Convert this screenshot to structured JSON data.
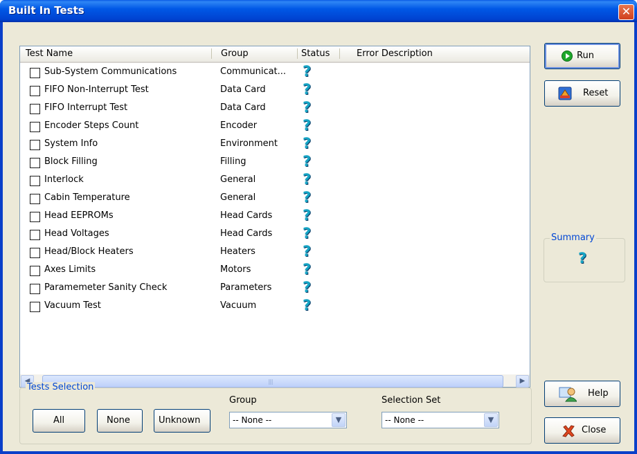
{
  "window": {
    "title": "Built In Tests",
    "close_glyph": "✕"
  },
  "list": {
    "columns": [
      "Test Name",
      "Group",
      "Status",
      "Error Description"
    ],
    "rows": [
      {
        "name": "Sub-System Communications",
        "group": "Communicat...",
        "status": "?"
      },
      {
        "name": "FIFO Non-Interrupt Test",
        "group": "Data Card",
        "status": "?"
      },
      {
        "name": "FIFO Interrupt Test",
        "group": "Data Card",
        "status": "?"
      },
      {
        "name": "Encoder Steps Count",
        "group": "Encoder",
        "status": "?"
      },
      {
        "name": "System Info",
        "group": "Environment",
        "status": "?"
      },
      {
        "name": "Block Filling",
        "group": "Filling",
        "status": "?"
      },
      {
        "name": "Interlock",
        "group": "General",
        "status": "?"
      },
      {
        "name": "Cabin Temperature",
        "group": "General",
        "status": "?"
      },
      {
        "name": "Head EEPROMs",
        "group": "Head Cards",
        "status": "?"
      },
      {
        "name": "Head Voltages",
        "group": "Head Cards",
        "status": "?"
      },
      {
        "name": "Head/Block Heaters",
        "group": "Heaters",
        "status": "?"
      },
      {
        "name": "Axes Limits",
        "group": "Motors",
        "status": "?"
      },
      {
        "name": "Paramemeter Sanity Check",
        "group": "Parameters",
        "status": "?"
      },
      {
        "name": "Vacuum Test",
        "group": "Vacuum",
        "status": "?"
      }
    ],
    "scroll_left_glyph": "◀",
    "scroll_right_glyph": "▶",
    "scroll_grip": "||||"
  },
  "buttons": {
    "run": {
      "label": "Run",
      "icon": "play-circle-icon"
    },
    "reset": {
      "label": "Reset",
      "icon": "reset-icon"
    },
    "help": {
      "label": "Help",
      "icon": "help-people-icon"
    },
    "close": {
      "label": "Close",
      "icon": "red-x-icon"
    }
  },
  "summary": {
    "label": "Summary",
    "status": "?"
  },
  "tests_selection": {
    "label": "Tests Selection",
    "all_label": "All",
    "none_label": "None",
    "unknown_label": "Unknown",
    "group_label": "Group",
    "group_value": "-- None --",
    "selection_set_label": "Selection Set",
    "selection_set_value": "-- None --",
    "dropdown_glyph": "▼"
  },
  "colors": {
    "title_bar": "#0058e6",
    "status_icon": "#16a5c5",
    "group_label": "#0046d5"
  }
}
